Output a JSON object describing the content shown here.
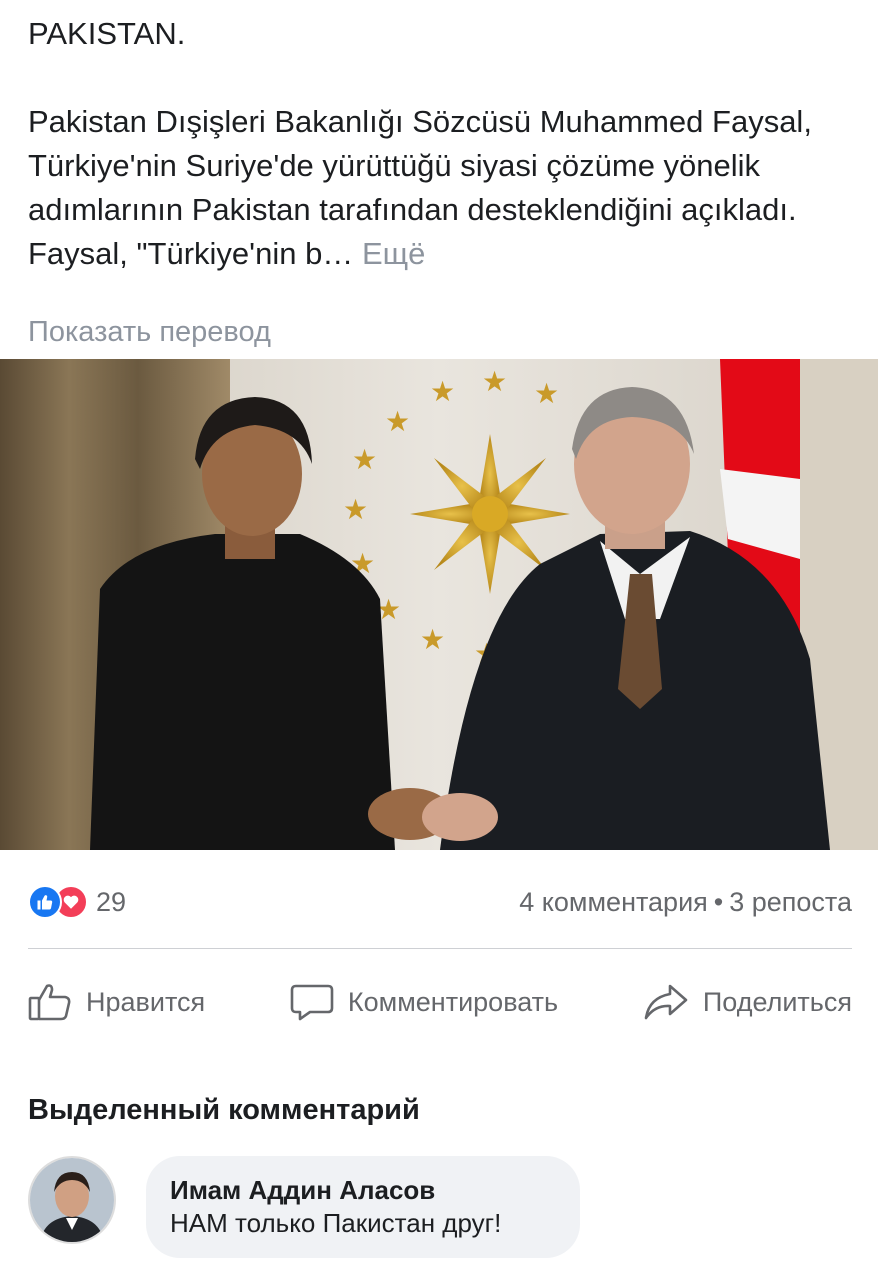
{
  "post": {
    "heading": "PAKISTAN.",
    "body": "Pakistan Dışişleri Bakanlığı Sözcüsü Muhammed Faysal, Türkiye'nin Suriye'de yürüttüğü siyasi çözüme yönelik adımlarının Pakistan tarafından desteklendiğini açıkladı. Faysal, \"Türkiye'nin b…",
    "see_more": "Ещё",
    "translate": "Показать перевод"
  },
  "stats": {
    "reactions": [
      "like-icon",
      "love-icon"
    ],
    "reaction_count": "29",
    "comments": "4 комментария",
    "separator": "•",
    "shares": "3 репоста"
  },
  "actions": {
    "like": "Нравится",
    "comment": "Комментировать",
    "share": "Поделиться"
  },
  "highlighted": {
    "title": "Выделенный комментарий",
    "author": "Имам Аддин Аласов",
    "text": "НАМ только Пакистан друг!"
  },
  "colors": {
    "like_blue": "#1877f2",
    "love_red": "#f33e58",
    "muted_text": "#65676b",
    "bubble_bg": "#f0f2f5",
    "flag_red": "#e30a17"
  }
}
